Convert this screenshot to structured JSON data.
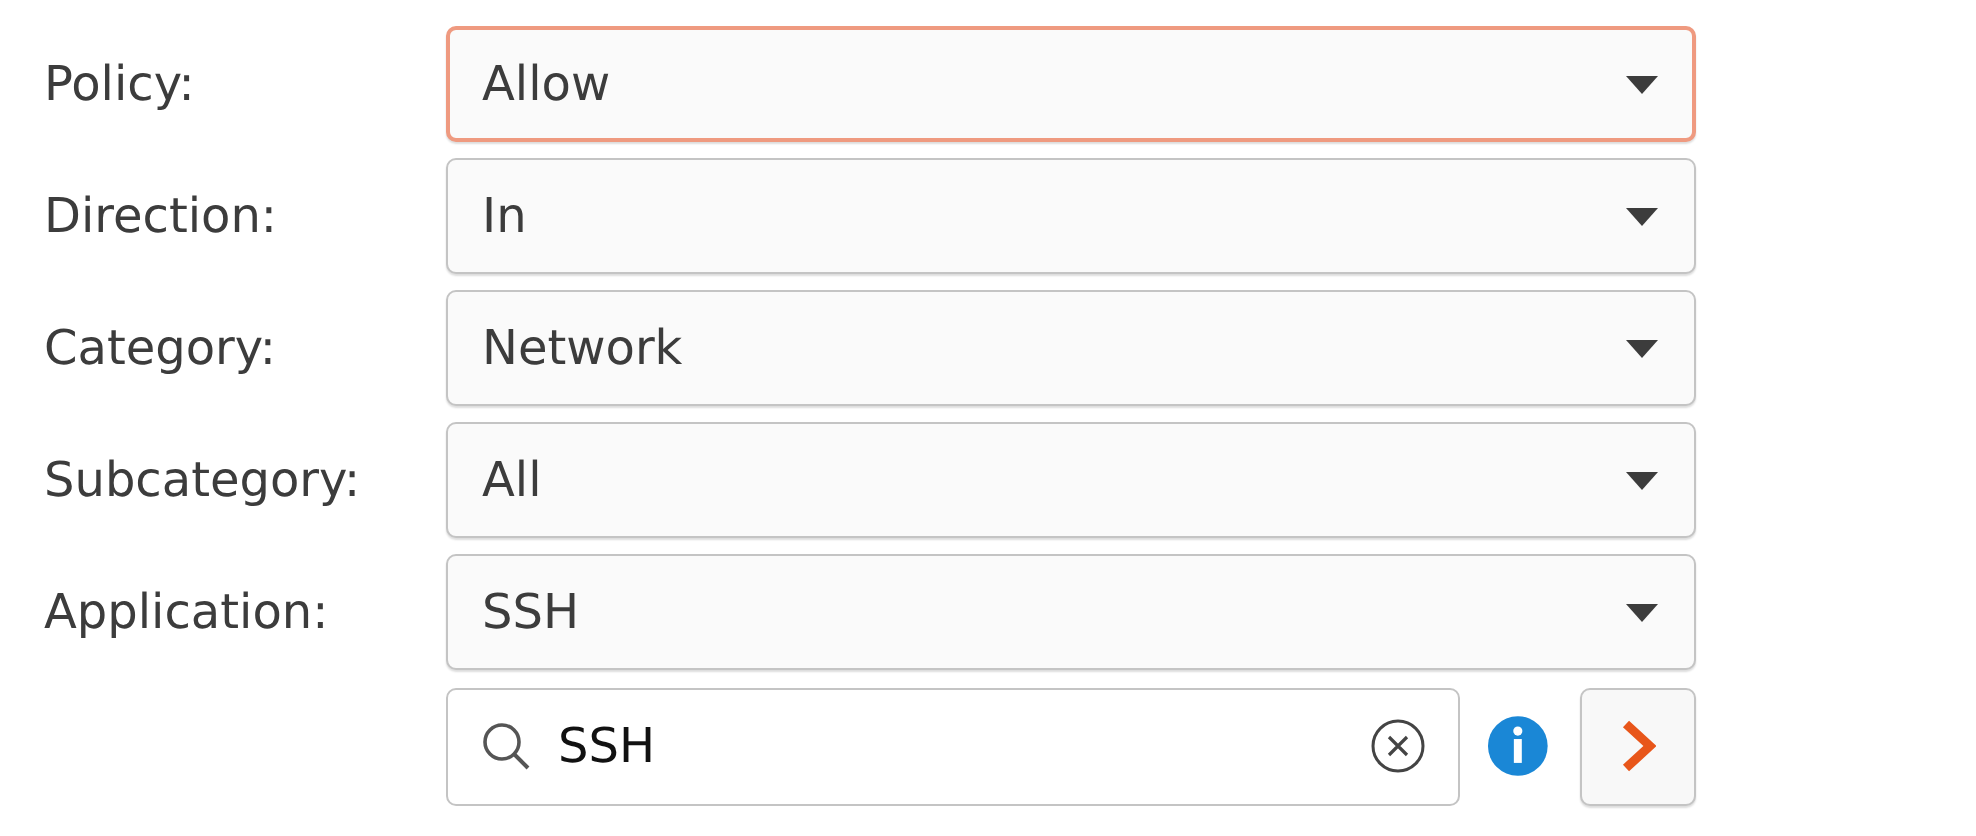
{
  "fields": [
    {
      "label": "Policy:",
      "value": "Allow",
      "focused": true
    },
    {
      "label": "Direction:",
      "value": "In",
      "focused": false
    },
    {
      "label": "Category:",
      "value": "Network",
      "focused": false
    },
    {
      "label": "Subcategory:",
      "value": "All",
      "focused": false
    },
    {
      "label": "Application:",
      "value": "SSH",
      "focused": false
    }
  ],
  "search": {
    "value": "SSH"
  }
}
